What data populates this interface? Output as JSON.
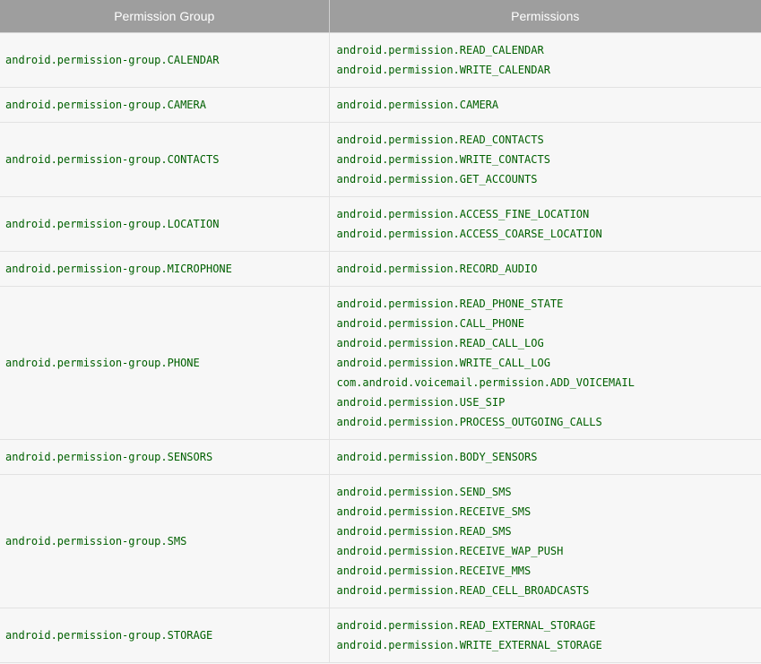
{
  "table": {
    "headers": [
      "Permission Group",
      "Permissions"
    ],
    "rows": [
      {
        "group": "android.permission-group.CALENDAR",
        "permissions": [
          "android.permission.READ_CALENDAR",
          "android.permission.WRITE_CALENDAR"
        ]
      },
      {
        "group": "android.permission-group.CAMERA",
        "permissions": [
          "android.permission.CAMERA"
        ]
      },
      {
        "group": "android.permission-group.CONTACTS",
        "permissions": [
          "android.permission.READ_CONTACTS",
          "android.permission.WRITE_CONTACTS",
          "android.permission.GET_ACCOUNTS"
        ]
      },
      {
        "group": "android.permission-group.LOCATION",
        "permissions": [
          "android.permission.ACCESS_FINE_LOCATION",
          "android.permission.ACCESS_COARSE_LOCATION"
        ]
      },
      {
        "group": "android.permission-group.MICROPHONE",
        "permissions": [
          "android.permission.RECORD_AUDIO"
        ]
      },
      {
        "group": "android.permission-group.PHONE",
        "permissions": [
          "android.permission.READ_PHONE_STATE",
          "android.permission.CALL_PHONE",
          "android.permission.READ_CALL_LOG",
          "android.permission.WRITE_CALL_LOG",
          "com.android.voicemail.permission.ADD_VOICEMAIL",
          "android.permission.USE_SIP",
          "android.permission.PROCESS_OUTGOING_CALLS"
        ]
      },
      {
        "group": "android.permission-group.SENSORS",
        "permissions": [
          "android.permission.BODY_SENSORS"
        ]
      },
      {
        "group": "android.permission-group.SMS",
        "permissions": [
          "android.permission.SEND_SMS",
          "android.permission.RECEIVE_SMS",
          "android.permission.READ_SMS",
          "android.permission.RECEIVE_WAP_PUSH",
          "android.permission.RECEIVE_MMS",
          "android.permission.READ_CELL_BROADCASTS"
        ]
      },
      {
        "group": "android.permission-group.STORAGE",
        "permissions": [
          "android.permission.READ_EXTERNAL_STORAGE",
          "android.permission.WRITE_EXTERNAL_STORAGE"
        ]
      }
    ]
  },
  "colors": {
    "header_bg": "#9e9e9e",
    "header_text": "#ffffff",
    "code_text": "#006000",
    "row_bg": "#f7f7f7",
    "border": "#e2e2e2"
  }
}
